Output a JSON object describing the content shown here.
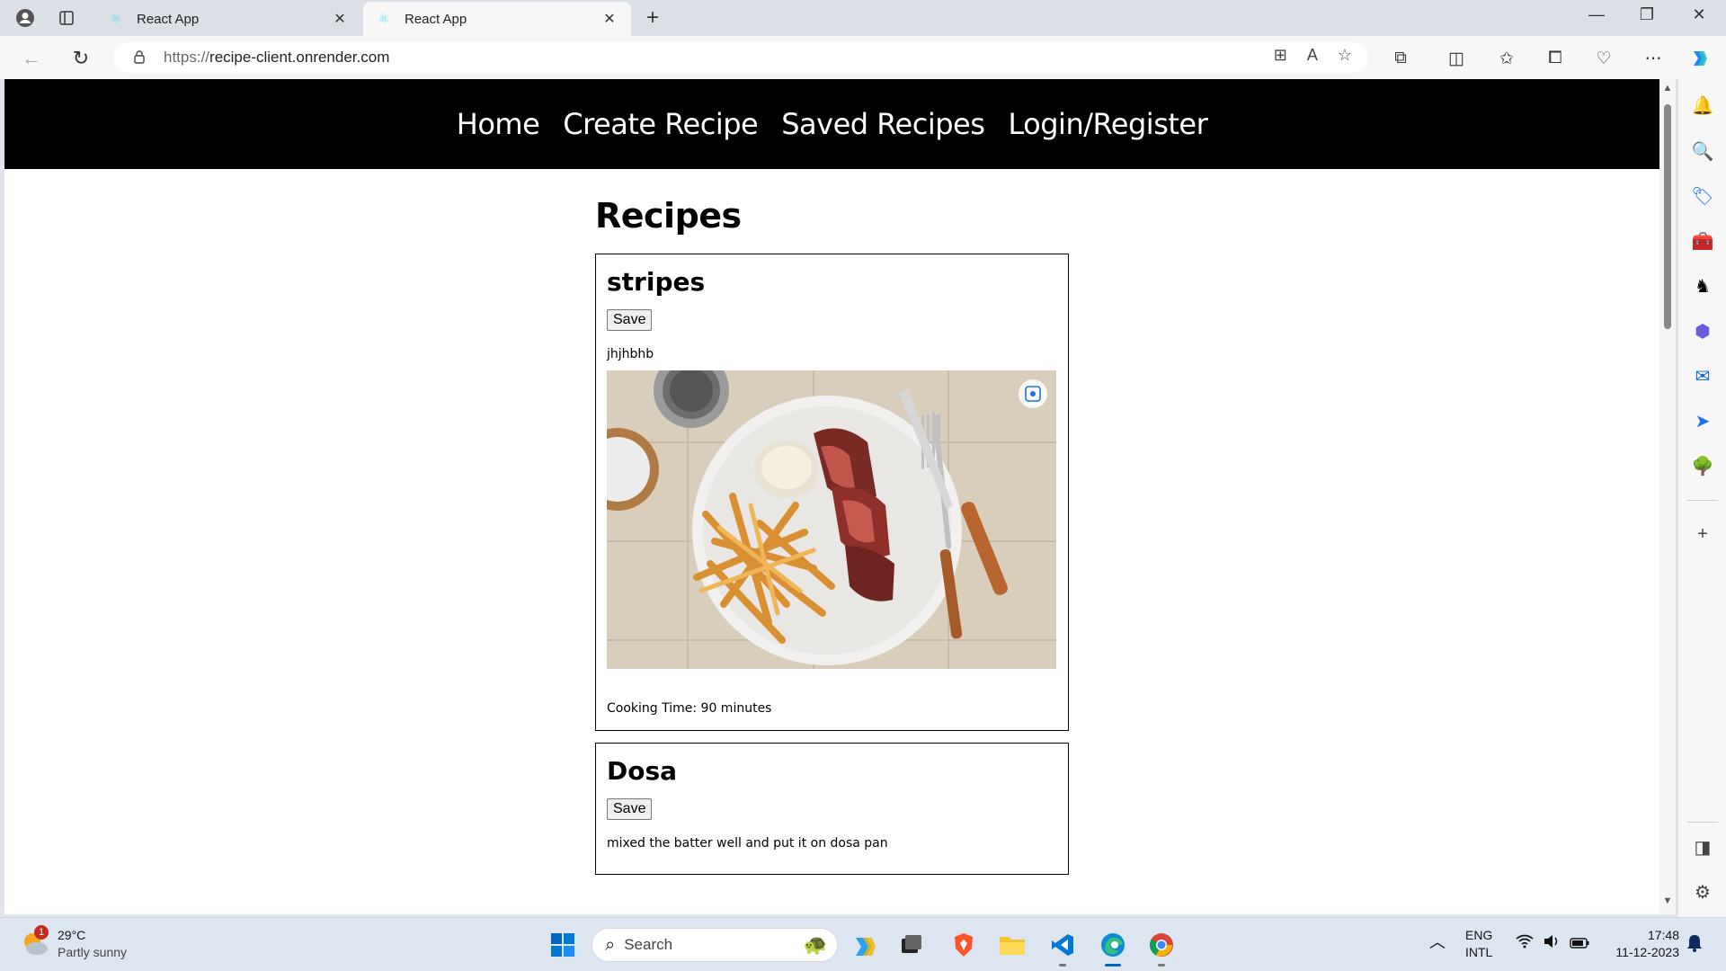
{
  "browser": {
    "tabs": [
      {
        "title": "React App",
        "active": false
      },
      {
        "title": "React App",
        "active": true
      }
    ],
    "url_scheme": "https://",
    "url_host": "recipe-client.onrender.com"
  },
  "site": {
    "nav": [
      "Home",
      "Create Recipe",
      "Saved Recipes",
      "Login/Register"
    ],
    "page_title": "Recipes",
    "recipes": [
      {
        "name": "stripes",
        "save_label": "Save",
        "instructions": "jhjhbhb",
        "cooking_time": "Cooking Time: 90 minutes",
        "image": "steak-and-fries-photo"
      },
      {
        "name": "Dosa",
        "save_label": "Save",
        "instructions": "mixed the batter well and put it on dosa pan"
      }
    ]
  },
  "taskbar": {
    "weather_temp": "29°C",
    "weather_desc": "Partly sunny",
    "weather_badge": "1",
    "search_placeholder": "Search",
    "lang_top": "ENG",
    "lang_bottom": "INTL",
    "time": "17:48",
    "date": "11-12-2023"
  },
  "colors": {
    "nav_bg": "#000000",
    "nav_text": "#ffffff",
    "accent": "#0067c0"
  }
}
